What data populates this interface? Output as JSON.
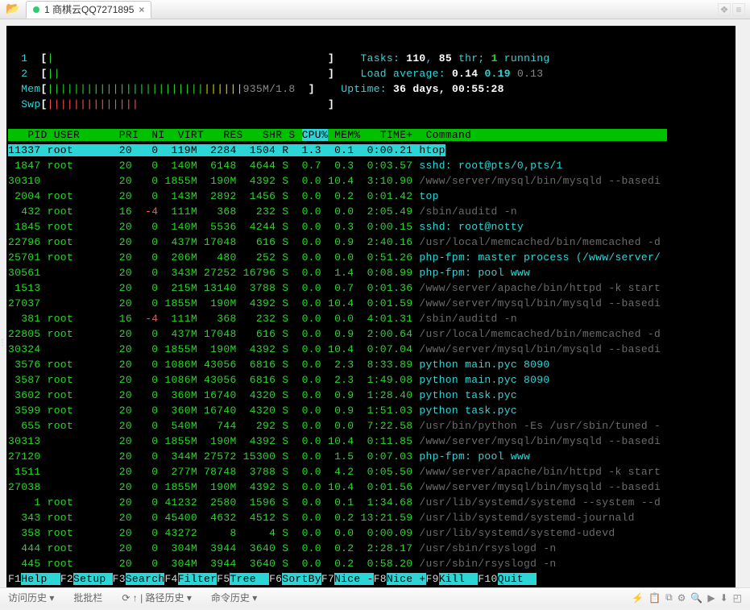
{
  "tab": {
    "title": "1 商棋云QQ7271895"
  },
  "htop": {
    "cpus": [
      {
        "id": "1",
        "bar": "[",
        "ticks_green": "|",
        "spaces": "                                          ",
        "close": "]"
      },
      {
        "id": "2",
        "bar": "[",
        "ticks_green": "||",
        "spaces": "                                         ",
        "close": "]"
      }
    ],
    "mem": {
      "label": "Mem",
      "open": "[",
      "ticks_green": "||||||||||||||||||||||||",
      "ticks_yellow": "||||||",
      "text": "935M/1.8",
      "close": "]"
    },
    "swp": {
      "label": "Swp",
      "open": "[",
      "ticks_red": "||||||||||||||",
      "spaces": "                             ",
      "close": "]"
    },
    "tasks": {
      "label": "Tasks:",
      "total": "110",
      "comma": ",",
      "thr": "85",
      "thr_lbl": " thr;",
      "run": "1",
      "run_lbl": " running"
    },
    "loadavg": {
      "label": "Load average:",
      "a": "0.14",
      "b": "0.19",
      "c": "0.13"
    },
    "uptime": {
      "label": "Uptime:",
      "val": "36 days, 00:55:28"
    },
    "columns": {
      "pid": "  PID",
      "user": "USER     ",
      "pri": "PRI",
      "ni": " NI",
      "virt": "VIRT",
      "res": " RES",
      "shr": " SHR",
      "s": "S",
      "cpu": "CPU%",
      "mem": "MEM%",
      "time": "  TIME+ ",
      "cmd": "Command"
    },
    "processes": [
      {
        "sel": true,
        "pid": "11337",
        "user": "root",
        "pri": "20",
        "ni": " 0",
        "nired": false,
        "virt": " 119M",
        "res": " 2284",
        "shr": " 1504",
        "s": "R",
        "cpu": " 1.3",
        "mem": " 0.1",
        "time": " 0:00.21",
        "cmd": "htop",
        "dim": false
      },
      {
        "sel": false,
        "pid": " 1847",
        "user": "root",
        "pri": "20",
        "ni": " 0",
        "nired": false,
        "virt": " 140M",
        "res": " 6148",
        "shr": " 4644",
        "s": "S",
        "cpu": " 0.7",
        "mem": " 0.3",
        "time": " 0:03.57",
        "cmd": "sshd: root@pts/0,pts/1",
        "dim": false
      },
      {
        "sel": false,
        "pid": "30310",
        "user": "",
        "pri": "20",
        "ni": " 0",
        "nired": false,
        "virt": "1855M",
        "res": " 190M",
        "shr": " 4392",
        "s": "S",
        "cpu": " 0.0",
        "mem": "10.4",
        "time": " 3:10.90",
        "cmd": "/www/server/mysql/bin/mysqld --basedi",
        "dim": true
      },
      {
        "sel": false,
        "pid": " 2004",
        "user": "root",
        "pri": "20",
        "ni": " 0",
        "nired": false,
        "virt": " 143M",
        "res": " 2892",
        "shr": " 1456",
        "s": "S",
        "cpu": " 0.0",
        "mem": " 0.2",
        "time": " 0:01.42",
        "cmd": "top",
        "dim": false
      },
      {
        "sel": false,
        "pid": "  432",
        "user": "root",
        "pri": "16",
        "ni": "-4",
        "nired": true,
        "virt": " 111M",
        "res": "  368",
        "shr": "  232",
        "s": "S",
        "cpu": " 0.0",
        "mem": " 0.0",
        "time": " 2:05.49",
        "cmd": "/sbin/auditd -n",
        "dim": true
      },
      {
        "sel": false,
        "pid": " 1845",
        "user": "root",
        "pri": "20",
        "ni": " 0",
        "nired": false,
        "virt": " 140M",
        "res": " 5536",
        "shr": " 4244",
        "s": "S",
        "cpu": " 0.0",
        "mem": " 0.3",
        "time": " 0:00.15",
        "cmd": "sshd: root@notty",
        "dim": false
      },
      {
        "sel": false,
        "pid": "22796",
        "user": "root",
        "pri": "20",
        "ni": " 0",
        "nired": false,
        "virt": " 437M",
        "res": "17048",
        "shr": "  616",
        "s": "S",
        "cpu": " 0.0",
        "mem": " 0.9",
        "time": " 2:40.16",
        "cmd": "/usr/local/memcached/bin/memcached -d",
        "dim": true
      },
      {
        "sel": false,
        "pid": "25701",
        "user": "root",
        "pri": "20",
        "ni": " 0",
        "nired": false,
        "virt": " 206M",
        "res": "  480",
        "shr": "  252",
        "s": "S",
        "cpu": " 0.0",
        "mem": " 0.0",
        "time": " 0:51.26",
        "cmd": "php-fpm: master process (/www/server/",
        "dim": false
      },
      {
        "sel": false,
        "pid": "30561",
        "user": "",
        "pri": "20",
        "ni": " 0",
        "nired": false,
        "virt": " 343M",
        "res": "27252",
        "shr": "16796",
        "s": "S",
        "cpu": " 0.0",
        "mem": " 1.4",
        "time": " 0:08.99",
        "cmd": "php-fpm: pool www",
        "dim": false
      },
      {
        "sel": false,
        "pid": " 1513",
        "user": "",
        "pri": "20",
        "ni": " 0",
        "nired": false,
        "virt": " 215M",
        "res": "13140",
        "shr": " 3788",
        "s": "S",
        "cpu": " 0.0",
        "mem": " 0.7",
        "time": " 0:01.36",
        "cmd": "/www/server/apache/bin/httpd -k start",
        "dim": true
      },
      {
        "sel": false,
        "pid": "27037",
        "user": "",
        "pri": "20",
        "ni": " 0",
        "nired": false,
        "virt": "1855M",
        "res": " 190M",
        "shr": " 4392",
        "s": "S",
        "cpu": " 0.0",
        "mem": "10.4",
        "time": " 0:01.59",
        "cmd": "/www/server/mysql/bin/mysqld --basedi",
        "dim": true
      },
      {
        "sel": false,
        "pid": "  381",
        "user": "root",
        "pri": "16",
        "ni": "-4",
        "nired": true,
        "virt": " 111M",
        "res": "  368",
        "shr": "  232",
        "s": "S",
        "cpu": " 0.0",
        "mem": " 0.0",
        "time": " 4:01.31",
        "cmd": "/sbin/auditd -n",
        "dim": true
      },
      {
        "sel": false,
        "pid": "22805",
        "user": "root",
        "pri": "20",
        "ni": " 0",
        "nired": false,
        "virt": " 437M",
        "res": "17048",
        "shr": "  616",
        "s": "S",
        "cpu": " 0.0",
        "mem": " 0.9",
        "time": " 2:00.64",
        "cmd": "/usr/local/memcached/bin/memcached -d",
        "dim": true
      },
      {
        "sel": false,
        "pid": "30324",
        "user": "",
        "pri": "20",
        "ni": " 0",
        "nired": false,
        "virt": "1855M",
        "res": " 190M",
        "shr": " 4392",
        "s": "S",
        "cpu": " 0.0",
        "mem": "10.4",
        "time": " 0:07.04",
        "cmd": "/www/server/mysql/bin/mysqld --basedi",
        "dim": true
      },
      {
        "sel": false,
        "pid": " 3576",
        "user": "root",
        "pri": "20",
        "ni": " 0",
        "nired": false,
        "virt": "1086M",
        "res": "43056",
        "shr": " 6816",
        "s": "S",
        "cpu": " 0.0",
        "mem": " 2.3",
        "time": " 8:33.89",
        "cmd": "python main.pyc 8090",
        "dim": false
      },
      {
        "sel": false,
        "pid": " 3587",
        "user": "root",
        "pri": "20",
        "ni": " 0",
        "nired": false,
        "virt": "1086M",
        "res": "43056",
        "shr": " 6816",
        "s": "S",
        "cpu": " 0.0",
        "mem": " 2.3",
        "time": " 1:49.08",
        "cmd": "python main.pyc 8090",
        "dim": false
      },
      {
        "sel": false,
        "pid": " 3602",
        "user": "root",
        "pri": "20",
        "ni": " 0",
        "nired": false,
        "virt": " 360M",
        "res": "16740",
        "shr": " 4320",
        "s": "S",
        "cpu": " 0.0",
        "mem": " 0.9",
        "time": " 1:28.40",
        "cmd": "python task.pyc",
        "dim": false
      },
      {
        "sel": false,
        "pid": " 3599",
        "user": "root",
        "pri": "20",
        "ni": " 0",
        "nired": false,
        "virt": " 360M",
        "res": "16740",
        "shr": " 4320",
        "s": "S",
        "cpu": " 0.0",
        "mem": " 0.9",
        "time": " 1:51.03",
        "cmd": "python task.pyc",
        "dim": false
      },
      {
        "sel": false,
        "pid": "  655",
        "user": "root",
        "pri": "20",
        "ni": " 0",
        "nired": false,
        "virt": " 540M",
        "res": "  744",
        "shr": "  292",
        "s": "S",
        "cpu": " 0.0",
        "mem": " 0.0",
        "time": " 7:22.58",
        "cmd": "/usr/bin/python -Es /usr/sbin/tuned -",
        "dim": true
      },
      {
        "sel": false,
        "pid": "30313",
        "user": "",
        "pri": "20",
        "ni": " 0",
        "nired": false,
        "virt": "1855M",
        "res": " 190M",
        "shr": " 4392",
        "s": "S",
        "cpu": " 0.0",
        "mem": "10.4",
        "time": " 0:11.85",
        "cmd": "/www/server/mysql/bin/mysqld --basedi",
        "dim": true
      },
      {
        "sel": false,
        "pid": "27120",
        "user": "",
        "pri": "20",
        "ni": " 0",
        "nired": false,
        "virt": " 344M",
        "res": "27572",
        "shr": "15300",
        "s": "S",
        "cpu": " 0.0",
        "mem": " 1.5",
        "time": " 0:07.03",
        "cmd": "php-fpm: pool www",
        "dim": false
      },
      {
        "sel": false,
        "pid": " 1511",
        "user": "",
        "pri": "20",
        "ni": " 0",
        "nired": false,
        "virt": " 277M",
        "res": "78748",
        "shr": " 3788",
        "s": "S",
        "cpu": " 0.0",
        "mem": " 4.2",
        "time": " 0:05.50",
        "cmd": "/www/server/apache/bin/httpd -k start",
        "dim": true
      },
      {
        "sel": false,
        "pid": "27038",
        "user": "",
        "pri": "20",
        "ni": " 0",
        "nired": false,
        "virt": "1855M",
        "res": " 190M",
        "shr": " 4392",
        "s": "S",
        "cpu": " 0.0",
        "mem": "10.4",
        "time": " 0:01.56",
        "cmd": "/www/server/mysql/bin/mysqld --basedi",
        "dim": true
      },
      {
        "sel": false,
        "pid": "    1",
        "user": "root",
        "pri": "20",
        "ni": " 0",
        "nired": false,
        "virt": "41232",
        "res": " 2580",
        "shr": " 1596",
        "s": "S",
        "cpu": " 0.0",
        "mem": " 0.1",
        "time": " 1:34.68",
        "cmd": "/usr/lib/systemd/systemd --system --d",
        "dim": true
      },
      {
        "sel": false,
        "pid": "  343",
        "user": "root",
        "pri": "20",
        "ni": " 0",
        "nired": false,
        "virt": "45400",
        "res": " 4632",
        "shr": " 4512",
        "s": "S",
        "cpu": " 0.0",
        "mem": " 0.2",
        "time": "13:21.59",
        "cmd": "/usr/lib/systemd/systemd-journald",
        "dim": true
      },
      {
        "sel": false,
        "pid": "  358",
        "user": "root",
        "pri": "20",
        "ni": " 0",
        "nired": false,
        "virt": "43272",
        "res": "    8",
        "shr": "    4",
        "s": "S",
        "cpu": " 0.0",
        "mem": " 0.0",
        "time": " 0:00.09",
        "cmd": "/usr/lib/systemd/systemd-udevd",
        "dim": true
      },
      {
        "sel": false,
        "pid": "  444",
        "user": "root",
        "pri": "20",
        "ni": " 0",
        "nired": false,
        "virt": " 304M",
        "res": " 3944",
        "shr": " 3640",
        "s": "S",
        "cpu": " 0.0",
        "mem": " 0.2",
        "time": " 2:28.17",
        "cmd": "/usr/sbin/rsyslogd -n",
        "dim": true
      },
      {
        "sel": false,
        "pid": "  445",
        "user": "root",
        "pri": "20",
        "ni": " 0",
        "nired": false,
        "virt": " 304M",
        "res": " 3944",
        "shr": " 3640",
        "s": "S",
        "cpu": " 0.0",
        "mem": " 0.2",
        "time": " 0:58.20",
        "cmd": "/usr/sbin/rsyslogd -n",
        "dim": true
      }
    ],
    "fkeys": [
      {
        "k": "F1",
        "l": "Help  "
      },
      {
        "k": "F2",
        "l": "Setup "
      },
      {
        "k": "F3",
        "l": "Search"
      },
      {
        "k": "F4",
        "l": "Filter"
      },
      {
        "k": "F5",
        "l": "Tree  "
      },
      {
        "k": "F6",
        "l": "SortBy"
      },
      {
        "k": "F7",
        "l": "Nice -"
      },
      {
        "k": "F8",
        "l": "Nice +"
      },
      {
        "k": "F9",
        "l": "Kill  "
      },
      {
        "k": "F10",
        "l": "Quit  "
      }
    ]
  },
  "status": {
    "a": "访问历史 ▾",
    "b": "批批栏",
    "c": "⟳  ↑ | 路径历史 ▾",
    "d": "命令历史 ▾"
  }
}
